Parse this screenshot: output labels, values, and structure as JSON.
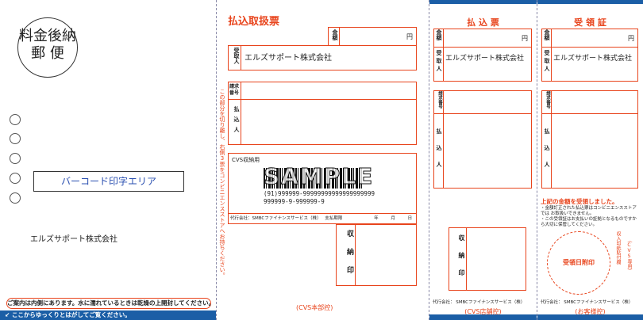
{
  "postage": {
    "line1": "料金後納",
    "line2": "郵 便"
  },
  "barcode_area_label": "バーコード印字エリア",
  "left_company": "エルズサポート株式会社",
  "left_notice": "ご案内は内側にあります。水に濡れているときは乾燥の上開封してください。",
  "left_peel": "ここからゆっくりとはがしてご覧ください。",
  "cut_note": "この部分を切り離し、右側3票をコンビニエンスストアへお持ちください。",
  "form": {
    "title": "払込取扱票",
    "amount_label": "金額",
    "yen": "円",
    "payee_label": "受取人",
    "payee_name": "エルズサポート株式会社",
    "invoice_no_label": "請求番号",
    "payer_label": "払込人",
    "cvs_label": "CVS収納用",
    "sample_text": "SAMPLE",
    "barcode_line1": "(91)999999-99999999999999999999",
    "barcode_line2": "999999-9-999999-9",
    "agent_text": "代行会社：SMBCファイナンスサービス（株）",
    "deadline_label": "支払期限",
    "year": "年",
    "month": "月",
    "day": "日",
    "stamp_label": "収納印",
    "footer": "(CVS本部控)"
  },
  "receipt_form": {
    "title": "払 込 票",
    "amount_label": "金額",
    "yen": "円",
    "payee_label": "受取人",
    "payee_name": "エルズサポート株式会社",
    "invoice_label": "請求番号",
    "payer_label": "払込人",
    "stamp_label": "収納印",
    "agent": "代行会社： SMBCファイナンスサービス（株）",
    "footer": "(CVS店舗控)"
  },
  "customer_receipt": {
    "title": "受 領 証",
    "amount_label": "金額",
    "yen": "円",
    "payee_label": "受取人",
    "payee_name": "エルズサポート株式会社",
    "invoice_label": "請求番号",
    "payer_label": "払込人",
    "received_text": "上記の金額を受領しました。",
    "note1": "・金額訂正された払込票はコンビニエンスストアでは お取扱いできません。",
    "note2": "・この受領証はお支払いの証拠となるものですから大切に保管してください。",
    "date_stamp": "受領日附印",
    "stamp_side": "収入印紙貼付欄",
    "stamp_side2": "（CVS専用）",
    "agent": "代行会社： SMBCファイナンスサービス（株）",
    "footer": "(お客様控)"
  },
  "colors": {
    "accent": "#e8441c",
    "blue": "#1b5ea6"
  }
}
